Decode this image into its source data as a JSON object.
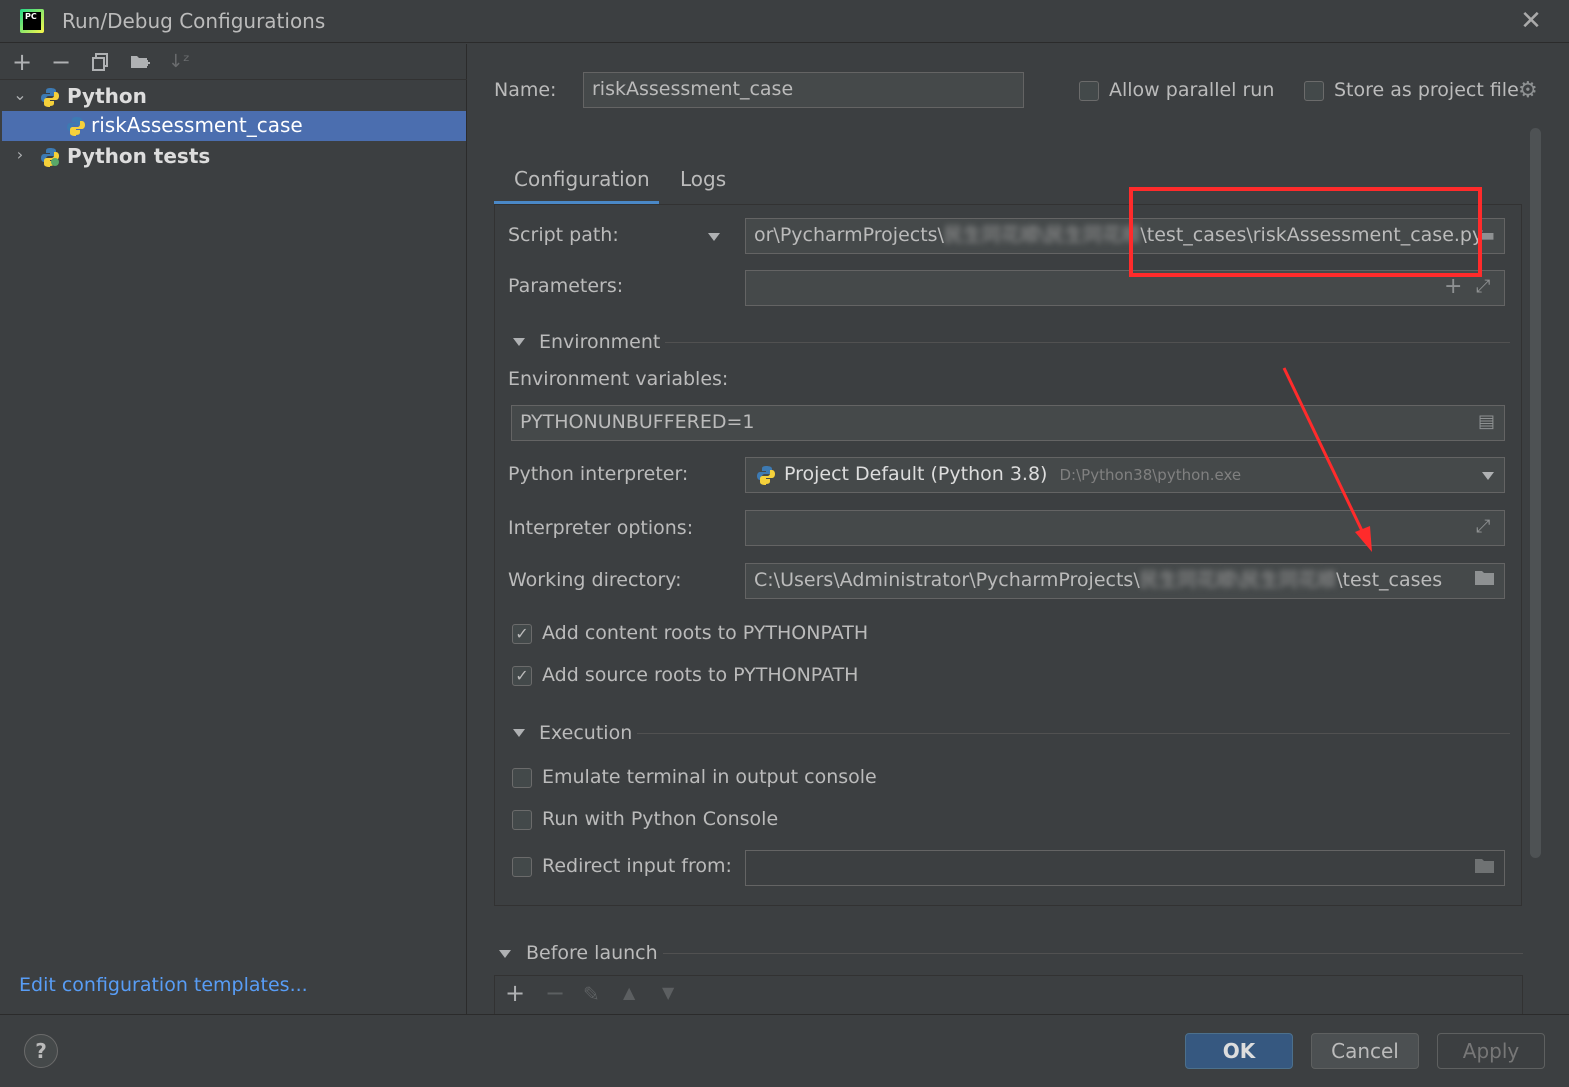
{
  "window": {
    "title": "Run/Debug Configurations",
    "app_icon_text": "PC"
  },
  "toolbar": {
    "icons": [
      "add-icon",
      "remove-icon",
      "copy-icon",
      "folder-add-icon",
      "sort-icon"
    ]
  },
  "tree": {
    "python": "Python",
    "python_item": "riskAssessment_case",
    "python_tests": "Python tests"
  },
  "edit_templates": "Edit configuration templates...",
  "header": {
    "name_label": "Name:",
    "name_value": "riskAssessment_case",
    "allow_parallel": "Allow parallel run",
    "store_as_file": "Store as project file"
  },
  "tabs": {
    "configuration": "Configuration",
    "logs": "Logs"
  },
  "config": {
    "script_path_label": "Script path:",
    "script_path_prefix": "or\\PycharmProjects\\",
    "script_path_blurred": "民生同花顺\\民生同花顺",
    "script_path_suffix": "\\test_cases\\riskAssessment_case.py",
    "parameters_label": "Parameters:",
    "parameters_value": "",
    "environment_section": "Environment",
    "env_vars_label": "Environment variables:",
    "env_vars_value": "PYTHONUNBUFFERED=1",
    "interpreter_label": "Python interpreter:",
    "interpreter_value": "Project Default (Python 3.8)",
    "interpreter_path": "D:\\Python38\\python.exe",
    "interpreter_options_label": "Interpreter options:",
    "interpreter_options_value": "",
    "working_dir_label": "Working directory:",
    "working_dir_prefix": "C:\\Users\\Administrator\\PycharmProjects\\",
    "working_dir_blurred": "民生同花顺\\民生同花顺",
    "working_dir_suffix": "\\test_cases",
    "add_content_roots": "Add content roots to PYTHONPATH",
    "add_content_roots_checked": true,
    "add_source_roots": "Add source roots to PYTHONPATH",
    "add_source_roots_checked": true,
    "execution_section": "Execution",
    "emulate_terminal": "Emulate terminal in output console",
    "run_with_console": "Run with Python Console",
    "redirect_input": "Redirect input from:",
    "redirect_input_value": ""
  },
  "before_launch": {
    "title": "Before launch"
  },
  "buttons": {
    "ok": "OK",
    "cancel": "Cancel",
    "apply": "Apply",
    "help": "?"
  },
  "colors": {
    "background": "#3c3f41",
    "selection": "#4b6eaf",
    "accent_blue": "#4a88c7",
    "link": "#589df6",
    "annotation_red": "#ff2b2b"
  }
}
